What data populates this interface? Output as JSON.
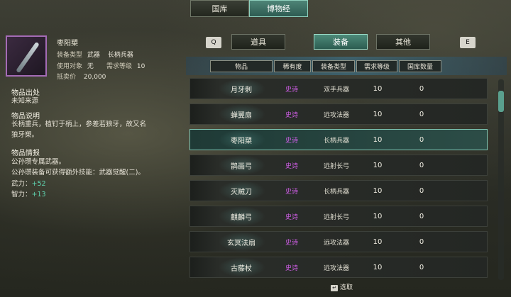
{
  "top_tabs": [
    {
      "label": "国库"
    },
    {
      "label": "博物经"
    }
  ],
  "item": {
    "name": "枣阳槊",
    "equip_type_label": "装备类型",
    "equip_type_value": "武器",
    "equip_subtype": "长柄兵器",
    "user_label": "使用对象",
    "user_value": "无",
    "req_level_label": "需求等级",
    "req_level_value": "10",
    "price_label": "抵卖价",
    "price_value": "20,000",
    "origin_title": "物品出处",
    "origin_text": "未知来源",
    "desc_title": "物品说明",
    "desc_text_1": "长柄重兵，植钉于柄上，参差若狼牙，故又名",
    "desc_text_2": "狼牙槊。",
    "info_title": "物品情报",
    "info_text_1": "公孙瓒专属武器。",
    "info_text_2": "公孙瓒装备可获得额外技能：武器觉醒(二)。",
    "stat1_label": "武力：",
    "stat1_value": "+52",
    "stat2_label": "智力：",
    "stat2_value": "+13"
  },
  "sub_tabs": {
    "prev_key": "Q",
    "next_key": "E",
    "tabs": [
      {
        "label": "道具"
      },
      {
        "label": "装备"
      },
      {
        "label": "其他"
      }
    ]
  },
  "columns": [
    "物品",
    "稀有度",
    "装备类型",
    "需求等级",
    "国库数量"
  ],
  "rows": [
    {
      "name": "月牙刺",
      "rarity": "史诗",
      "type": "双手兵器",
      "req": "10",
      "qty": "0"
    },
    {
      "name": "蝉翼扇",
      "rarity": "史诗",
      "type": "远攻法器",
      "req": "10",
      "qty": "0"
    },
    {
      "name": "枣阳槊",
      "rarity": "史诗",
      "type": "长柄兵器",
      "req": "10",
      "qty": "0"
    },
    {
      "name": "鹊画弓",
      "rarity": "史诗",
      "type": "远射长弓",
      "req": "10",
      "qty": "0"
    },
    {
      "name": "灭贼刀",
      "rarity": "史诗",
      "type": "长柄兵器",
      "req": "10",
      "qty": "0"
    },
    {
      "name": "麒麟弓",
      "rarity": "史诗",
      "type": "远射长弓",
      "req": "10",
      "qty": "0"
    },
    {
      "name": "玄冥法扇",
      "rarity": "史诗",
      "type": "远攻法器",
      "req": "10",
      "qty": "0"
    },
    {
      "name": "古藤杖",
      "rarity": "史诗",
      "type": "远攻法器",
      "req": "10",
      "qty": "0"
    }
  ],
  "footer": {
    "hint": "选取"
  },
  "colors": {
    "accent": "#4e8577",
    "rarity_epic": "#d05ee8",
    "stat_green": "#5fd4b0"
  }
}
